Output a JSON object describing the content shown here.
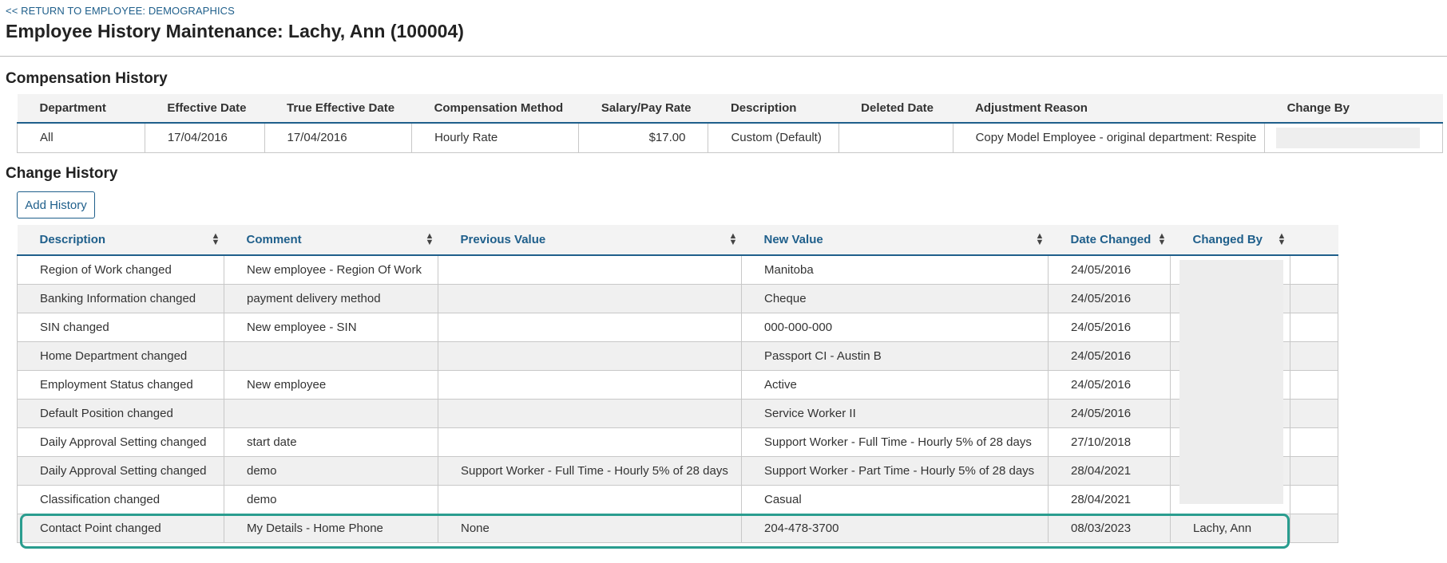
{
  "header": {
    "return_link": "<< RETURN TO EMPLOYEE: DEMOGRAPHICS",
    "title": "Employee History Maintenance: Lachy, Ann (100004)"
  },
  "compensation": {
    "heading": "Compensation History",
    "columns": [
      "Department",
      "Effective Date",
      "True Effective Date",
      "Compensation Method",
      "Salary/Pay Rate",
      "Description",
      "Deleted Date",
      "Adjustment Reason",
      "Change By"
    ],
    "rows": [
      [
        "All",
        "17/04/2016",
        "17/04/2016",
        "Hourly Rate",
        "$17.00",
        "Custom (Default)",
        "",
        "Copy Model Employee - original department: Respite",
        ""
      ]
    ]
  },
  "change_history": {
    "heading": "Change History",
    "add_button": "Add History",
    "columns": [
      "Description",
      "Comment",
      "Previous Value",
      "New Value",
      "Date Changed",
      "Changed By"
    ],
    "rows": [
      [
        "Region of Work changed",
        "New employee - Region Of Work",
        "",
        "Manitoba",
        "24/05/2016",
        ""
      ],
      [
        "Banking Information changed",
        "payment delivery method",
        "",
        "Cheque",
        "24/05/2016",
        ""
      ],
      [
        "SIN changed",
        "New employee - SIN",
        "",
        "000-000-000",
        "24/05/2016",
        ""
      ],
      [
        "Home Department changed",
        "",
        "",
        "Passport CI - Austin B",
        "24/05/2016",
        ""
      ],
      [
        "Employment Status changed",
        "New employee",
        "",
        "Active",
        "24/05/2016",
        ""
      ],
      [
        "Default Position changed",
        "",
        "",
        "Service Worker II",
        "24/05/2016",
        ""
      ],
      [
        "Daily Approval Setting changed",
        "start date",
        "",
        "Support Worker - Full Time - Hourly 5% of 28 days",
        "27/10/2018",
        ""
      ],
      [
        "Daily Approval Setting changed",
        "demo",
        "Support Worker - Full Time - Hourly 5% of 28 days",
        "Support Worker - Part Time - Hourly 5% of 28 days",
        "28/04/2021",
        ""
      ],
      [
        "Classification changed",
        "demo",
        "",
        "Casual",
        "28/04/2021",
        ""
      ],
      [
        "Contact Point changed",
        "My Details - Home Phone",
        "None",
        "204-478-3700",
        "08/03/2023",
        "Lachy, Ann"
      ]
    ]
  },
  "icons": {
    "sort": "sort-icon"
  },
  "colors": {
    "link": "#1f5f8b",
    "highlight": "#2a9d8f",
    "header_bg": "#f3f3f3",
    "stripe": "#f0f0f0"
  }
}
